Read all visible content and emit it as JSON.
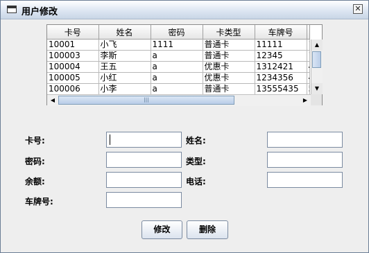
{
  "window": {
    "title": "用户修改"
  },
  "table": {
    "columns": [
      "卡号",
      "姓名",
      "密码",
      "卡类型",
      "车牌号"
    ],
    "overflow_column": [
      "1",
      "1",
      "4",
      "4",
      "5"
    ],
    "rows": [
      [
        "10001",
        "小飞",
        "1111",
        "普通卡",
        "11111"
      ],
      [
        "100003",
        "李斯",
        "a",
        "普通卡",
        "12345"
      ],
      [
        "100004",
        "王五",
        "a",
        "优惠卡",
        "1312421"
      ],
      [
        "100005",
        "小红",
        "a",
        "优惠卡",
        "1234356"
      ],
      [
        "100006",
        "小李",
        "a",
        "普通卡",
        "13555435"
      ]
    ]
  },
  "form": {
    "card_label": "卡号:",
    "name_label": "姓名:",
    "password_label": "密码:",
    "type_label": "类型:",
    "balance_label": "余额:",
    "phone_label": "电话:",
    "plate_label": "车牌号:",
    "card_value": "",
    "name_value": "",
    "password_value": "",
    "type_value": "",
    "balance_value": "",
    "phone_value": "",
    "plate_value": ""
  },
  "buttons": {
    "modify": "修改",
    "delete": "删除"
  },
  "icons": {
    "window": "window-icon",
    "close": "close-icon",
    "scroll_up": "arrow-up-icon",
    "scroll_down": "arrow-down-icon",
    "scroll_left": "arrow-left-icon",
    "scroll_right": "arrow-right-icon"
  }
}
